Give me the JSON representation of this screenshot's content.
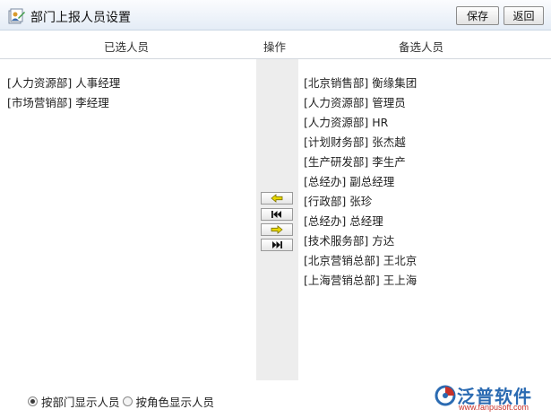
{
  "window": {
    "title": "部门上报人员设置"
  },
  "toolbar": {
    "save_label": "保存",
    "back_label": "返回"
  },
  "columns": {
    "selected": "已选人员",
    "operation": "操作",
    "available": "备选人员"
  },
  "selected_people": [
    "[人力资源部] 人事经理",
    "[市场营销部] 李经理"
  ],
  "available_people": [
    "[北京销售部] 衡缘集团",
    "[人力资源部] 管理员",
    "[人力资源部] HR",
    "[计划财务部] 张杰越",
    "[生产研发部] 李生产",
    "[总经办] 副总经理",
    "[行政部] 张珍",
    "[总经办] 总经理",
    "[技术服务部] 方达",
    "[北京营销总部] 王北京",
    "[上海营销总部] 王上海"
  ],
  "operation_buttons": {
    "move_left": "arrow-left-icon",
    "move_all_left": "double-arrow-left-icon",
    "move_right": "arrow-right-icon",
    "move_all_right": "double-arrow-right-icon"
  },
  "display_mode": {
    "by_department": "按部门显示人员",
    "by_role": "按角色显示人员",
    "selected": "by_department"
  },
  "logo": {
    "name": "泛普软件",
    "url": "www.fanpusoft.com"
  },
  "colors": {
    "arrow": "#e8d800",
    "arrow_stroke": "#7a7000",
    "logo_blue": "#2b6bb2",
    "logo_red": "#c8312a"
  }
}
